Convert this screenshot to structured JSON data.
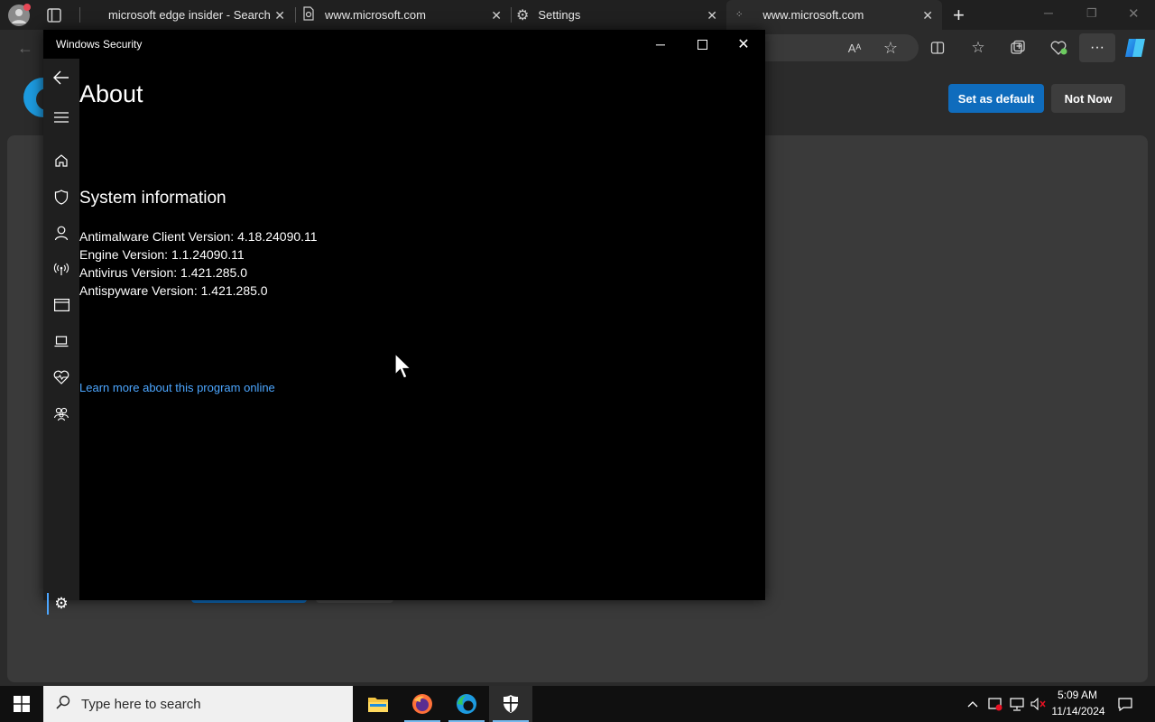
{
  "browser": {
    "tabs": [
      {
        "title": "microsoft edge insider - Search",
        "active": false
      },
      {
        "title": "www.microsoft.com",
        "active": false
      },
      {
        "title": "Settings",
        "active": false
      },
      {
        "title": "www.microsoft.com",
        "active": true
      }
    ],
    "new_tab_symbol": "+"
  },
  "edge_page": {
    "set_default_label": "Set as default",
    "not_now_label": "Not Now"
  },
  "security_window": {
    "title": "Windows Security",
    "page_title": "About",
    "section_title": "System information",
    "info_lines": [
      "Antimalware Client Version: 4.18.24090.11",
      "Engine Version: 1.1.24090.11",
      "Antivirus Version: 1.421.285.0",
      "Antispyware Version: 1.421.285.0"
    ],
    "learn_more_link": "Learn more about this program online",
    "nav_icons": [
      "back-icon",
      "hamburger-icon",
      "home-icon",
      "shield-icon",
      "person-icon",
      "wireless-icon",
      "app-browser-icon",
      "laptop-icon",
      "heart-icon",
      "family-icon",
      "settings-icon"
    ]
  },
  "taskbar": {
    "search_placeholder": "Type here to search",
    "apps": [
      "file-explorer-icon",
      "firefox-icon",
      "edge-icon",
      "windows-security-icon"
    ],
    "time": "5:09 AM",
    "date": "11/14/2024"
  },
  "colors": {
    "accent_blue": "#0f6cbd",
    "link_blue": "#4ca6ff",
    "window_bg": "#000000"
  }
}
